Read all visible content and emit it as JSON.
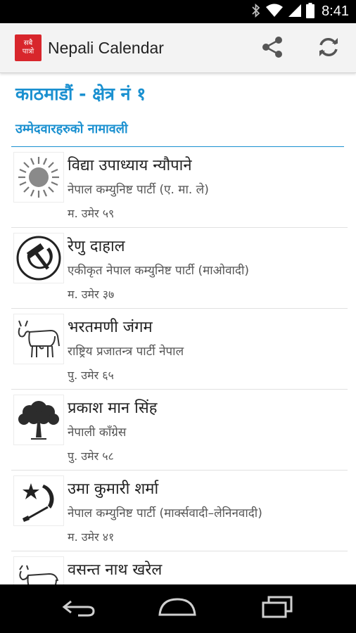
{
  "status_bar": {
    "time": "8:41",
    "icons": [
      "bluetooth-icon",
      "wifi-icon",
      "signal-icon",
      "battery-icon"
    ]
  },
  "app_bar": {
    "logo_text_line1": "सबै",
    "logo_text_line2": "पात्रो",
    "title": "Nepali Calendar",
    "actions": [
      "share-icon",
      "refresh-icon"
    ]
  },
  "page": {
    "title": "काठमाडौं - क्षेत्र नं १",
    "section_title": "उम्मेदवारहरुको नामावली"
  },
  "candidates": [
    {
      "name": "विद्या उपाध्याय न्यौपाने",
      "party": "नेपाल कम्युनिष्ट पार्टी (ए. मा. ले)",
      "age": "म. उमेर ५९",
      "symbol": "sun-icon"
    },
    {
      "name": "रेणु दाहाल",
      "party": "एकीकृत नेपाल कम्युनिष्ट पार्टी (माओवादी)",
      "age": "म. उमेर ३७",
      "symbol": "hammer-sickle-icon"
    },
    {
      "name": "भरतमणी जंगम",
      "party": "राष्ट्रिय प्रजातन्त्र पार्टी नेपाल",
      "age": "पु. उमेर ६५",
      "symbol": "cow-icon"
    },
    {
      "name": "प्रकाश मान सिंह",
      "party": "नेपाली काँग्रेस",
      "age": "पु. उमेर ५८",
      "symbol": "tree-icon"
    },
    {
      "name": "उमा कुमारी शर्मा",
      "party": "नेपाल कम्युनिष्ट पार्टी (मार्क्सवादी–लेनिनवादी)",
      "age": "म. उमेर ४१",
      "symbol": "star-sickle-icon"
    },
    {
      "name": "वसन्त नाथ खरेल",
      "party": "",
      "age": "",
      "symbol": "ox-icon"
    }
  ],
  "colors": {
    "accent": "#1a90d0",
    "app_bar_bg": "#f3f3f3",
    "logo_red": "#d8262c"
  },
  "nav_bar": {
    "buttons": [
      "back-icon",
      "home-icon",
      "recents-icon"
    ]
  }
}
